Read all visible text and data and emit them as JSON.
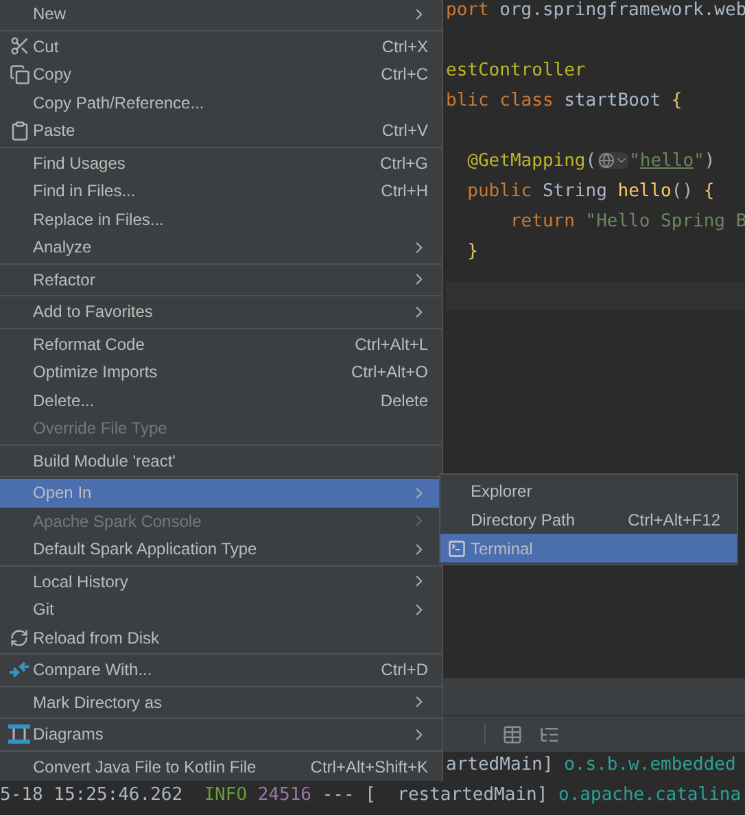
{
  "editor": {
    "lines": [
      {
        "kind": "code",
        "tokens": [
          {
            "kind": "keyword",
            "text": "port"
          },
          {
            "kind": "plain",
            "text": " org.springframework.web"
          }
        ]
      },
      {
        "kind": "blank"
      },
      {
        "kind": "code",
        "tokens": [
          {
            "kind": "annotation",
            "text": "estController"
          }
        ]
      },
      {
        "kind": "code",
        "tokens": [
          {
            "kind": "keyword",
            "text": "blic class"
          },
          {
            "kind": "plain",
            "text": " startBoot "
          },
          {
            "kind": "brace",
            "text": "{"
          }
        ]
      },
      {
        "kind": "blank"
      },
      {
        "kind": "code",
        "tokens": [
          {
            "kind": "annotation",
            "text": "  @GetMapping"
          },
          {
            "kind": "plain",
            "text": "("
          },
          {
            "kind": "hint"
          },
          {
            "kind": "string",
            "text": "\""
          },
          {
            "kind": "link",
            "text": "hello"
          },
          {
            "kind": "string",
            "text": "\""
          },
          {
            "kind": "plain",
            "text": ")"
          }
        ]
      },
      {
        "kind": "code",
        "tokens": [
          {
            "kind": "keyword",
            "text": "  public"
          },
          {
            "kind": "plain",
            "text": " String "
          },
          {
            "kind": "method",
            "text": "hello"
          },
          {
            "kind": "plain",
            "text": "() "
          },
          {
            "kind": "brace",
            "text": "{"
          }
        ]
      },
      {
        "kind": "code",
        "tokens": [
          {
            "kind": "keyword",
            "text": "      return"
          },
          {
            "kind": "string",
            "text": " \"Hello Spring B"
          }
        ]
      },
      {
        "kind": "code",
        "tokens": [
          {
            "kind": "brace",
            "text": "  }"
          }
        ]
      }
    ]
  },
  "console": {
    "lines": [
      {
        "tokens": [
          {
            "kind": "plain",
            "text": "artedMain] "
          },
          {
            "kind": "logger",
            "text": "o.s.b.w.embedded"
          }
        ]
      },
      {
        "tokens": [
          {
            "kind": "plain",
            "text": "5-18 15:25:46.262  "
          },
          {
            "kind": "info",
            "text": "INFO"
          },
          {
            "kind": "pid",
            "text": " 24516"
          },
          {
            "kind": "plain",
            "text": " --- [  restartedMain] "
          },
          {
            "kind": "logger",
            "text": "o.apache.catalina"
          }
        ]
      }
    ]
  },
  "context_menu": {
    "items": [
      {
        "kind": "item",
        "label": "New",
        "submenu": true,
        "selected": false,
        "disabled": false
      },
      {
        "kind": "separator"
      },
      {
        "kind": "item",
        "label": "Cut",
        "shortcut": "Ctrl+X",
        "submenu": false,
        "selected": false,
        "disabled": false
      },
      {
        "kind": "item",
        "label": "Copy",
        "shortcut": "Ctrl+C",
        "submenu": false,
        "selected": false,
        "disabled": false
      },
      {
        "kind": "item",
        "label": "Copy Path/Reference...",
        "submenu": false,
        "selected": false,
        "disabled": false
      },
      {
        "kind": "item",
        "label": "Paste",
        "shortcut": "Ctrl+V",
        "submenu": false,
        "selected": false,
        "disabled": false
      },
      {
        "kind": "separator"
      },
      {
        "kind": "item",
        "label": "Find Usages",
        "shortcut": "Ctrl+G",
        "submenu": false,
        "selected": false,
        "disabled": false
      },
      {
        "kind": "item",
        "label": "Find in Files...",
        "shortcut": "Ctrl+H",
        "submenu": false,
        "selected": false,
        "disabled": false
      },
      {
        "kind": "item",
        "label": "Replace in Files...",
        "submenu": false,
        "selected": false,
        "disabled": false
      },
      {
        "kind": "item",
        "label": "Analyze",
        "submenu": true,
        "selected": false,
        "disabled": false
      },
      {
        "kind": "separator"
      },
      {
        "kind": "item",
        "label": "Refactor",
        "submenu": true,
        "selected": false,
        "disabled": false
      },
      {
        "kind": "separator"
      },
      {
        "kind": "item",
        "label": "Add to Favorites",
        "submenu": true,
        "selected": false,
        "disabled": false
      },
      {
        "kind": "separator"
      },
      {
        "kind": "item",
        "label": "Reformat Code",
        "shortcut": "Ctrl+Alt+L",
        "submenu": false,
        "selected": false,
        "disabled": false
      },
      {
        "kind": "item",
        "label": "Optimize Imports",
        "shortcut": "Ctrl+Alt+O",
        "submenu": false,
        "selected": false,
        "disabled": false
      },
      {
        "kind": "item",
        "label": "Delete...",
        "shortcut": "Delete",
        "submenu": false,
        "selected": false,
        "disabled": false
      },
      {
        "kind": "item",
        "label": "Override File Type",
        "submenu": false,
        "selected": false,
        "disabled": true
      },
      {
        "kind": "separator"
      },
      {
        "kind": "item",
        "label": "Build Module 'react'",
        "submenu": false,
        "selected": false,
        "disabled": false
      },
      {
        "kind": "separator"
      },
      {
        "kind": "item",
        "label": "Open In",
        "submenu": true,
        "selected": true,
        "disabled": false
      },
      {
        "kind": "item",
        "label": "Apache Spark Console",
        "submenu": true,
        "selected": false,
        "disabled": true
      },
      {
        "kind": "item",
        "label": "Default Spark Application Type",
        "submenu": true,
        "selected": false,
        "disabled": false
      },
      {
        "kind": "separator"
      },
      {
        "kind": "item",
        "label": "Local History",
        "submenu": true,
        "selected": false,
        "disabled": false
      },
      {
        "kind": "item",
        "label": "Git",
        "submenu": true,
        "selected": false,
        "disabled": false
      },
      {
        "kind": "item",
        "label": "Reload from Disk",
        "submenu": false,
        "selected": false,
        "disabled": false
      },
      {
        "kind": "separator"
      },
      {
        "kind": "item",
        "label": "Compare With...",
        "shortcut": "Ctrl+D",
        "submenu": false,
        "selected": false,
        "disabled": false
      },
      {
        "kind": "separator"
      },
      {
        "kind": "item",
        "label": "Mark Directory as",
        "submenu": true,
        "selected": false,
        "disabled": false
      },
      {
        "kind": "separator"
      },
      {
        "kind": "item",
        "label": "Diagrams",
        "submenu": true,
        "selected": false,
        "disabled": false
      },
      {
        "kind": "separator"
      },
      {
        "kind": "item",
        "label": "Convert Java File to Kotlin File",
        "shortcut": "Ctrl+Alt+Shift+K",
        "submenu": false,
        "selected": false,
        "disabled": false
      }
    ]
  },
  "submenu": {
    "items": [
      {
        "label": "Explorer",
        "selected": false
      },
      {
        "label": "Directory Path",
        "shortcut": "Ctrl+Alt+F12",
        "selected": false
      },
      {
        "label": "Terminal",
        "selected": true
      }
    ]
  }
}
